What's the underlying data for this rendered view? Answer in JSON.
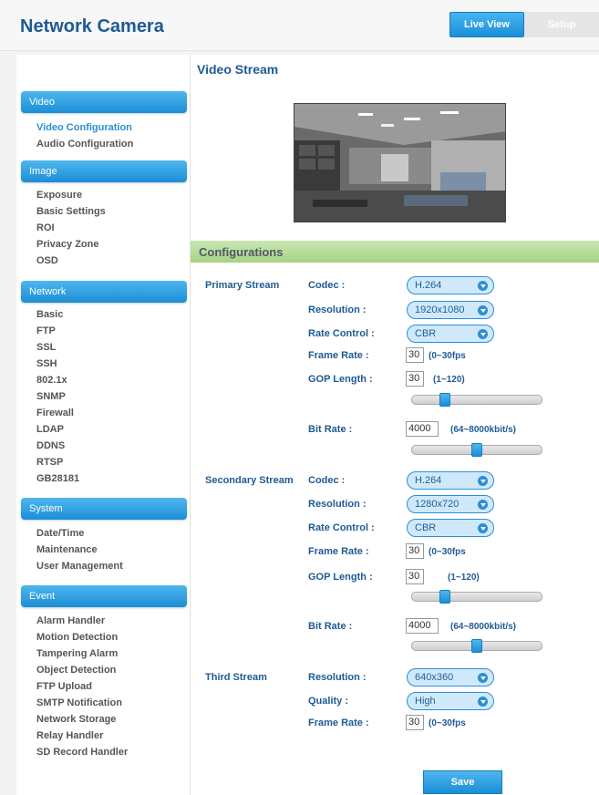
{
  "app": {
    "title": "Network Camera"
  },
  "top_tabs": [
    {
      "label": "Live View"
    },
    {
      "label": "Setup"
    }
  ],
  "sidebar": {
    "video": {
      "header": "Video",
      "items": [
        "Video Configuration",
        "Audio Configuration"
      ]
    },
    "image": {
      "header": "Image",
      "items": [
        "Exposure",
        "Basic Settings",
        "ROI",
        "Privacy Zone",
        "OSD"
      ]
    },
    "network": {
      "header": "Network",
      "items": [
        "Basic",
        "FTP",
        "SSL",
        "SSH",
        "802.1x",
        "SNMP",
        "Firewall",
        "LDAP",
        "DDNS",
        "RTSP",
        "GB28181"
      ]
    },
    "system": {
      "header": "System",
      "items": [
        "Date/Time",
        "Maintenance",
        "User Management"
      ]
    },
    "event": {
      "header": "Event",
      "items": [
        "Alarm Handler",
        "Motion Detection",
        "Tampering Alarm",
        "Object Detection",
        "FTP Upload",
        "SMTP Notification",
        "Network Storage",
        "Relay Handler",
        "SD Record Handler"
      ]
    }
  },
  "main": {
    "title": "Video Stream",
    "config_title": "Configurations",
    "labels": {
      "codec": "Codec :",
      "resolution": "Resolution :",
      "rate_control": "Rate Control :",
      "frame_rate": "Frame Rate :",
      "gop_length": "GOP Length :",
      "bit_rate": "Bit Rate :",
      "quality": "Quality :"
    },
    "primary": {
      "label": "Primary Stream",
      "codec": "H.264",
      "resolution": "1920x1080",
      "rate_control": "CBR",
      "frame_rate": "30",
      "frame_rate_range": "(0~30fps",
      "gop": "30",
      "gop_range": "(1~120)",
      "gop_slider": 0.25,
      "bitrate": "4000",
      "bitrate_range": "(64~8000kbit/s)",
      "bitrate_slider": 0.5
    },
    "secondary": {
      "label": "Secondary Stream",
      "codec": "H.264",
      "resolution": "1280x720",
      "rate_control": "CBR",
      "frame_rate": "30",
      "frame_rate_range": "(0~30fps",
      "gop": "30",
      "gop_range": "(1~120)",
      "gop_slider": 0.25,
      "bitrate": "4000",
      "bitrate_range": "(64~8000kbit/s)",
      "bitrate_slider": 0.5
    },
    "third": {
      "label": "Third Stream",
      "resolution": "640x360",
      "quality": "High",
      "frame_rate": "30",
      "frame_rate_range": "(0~30fps"
    },
    "save_label": "Save"
  }
}
